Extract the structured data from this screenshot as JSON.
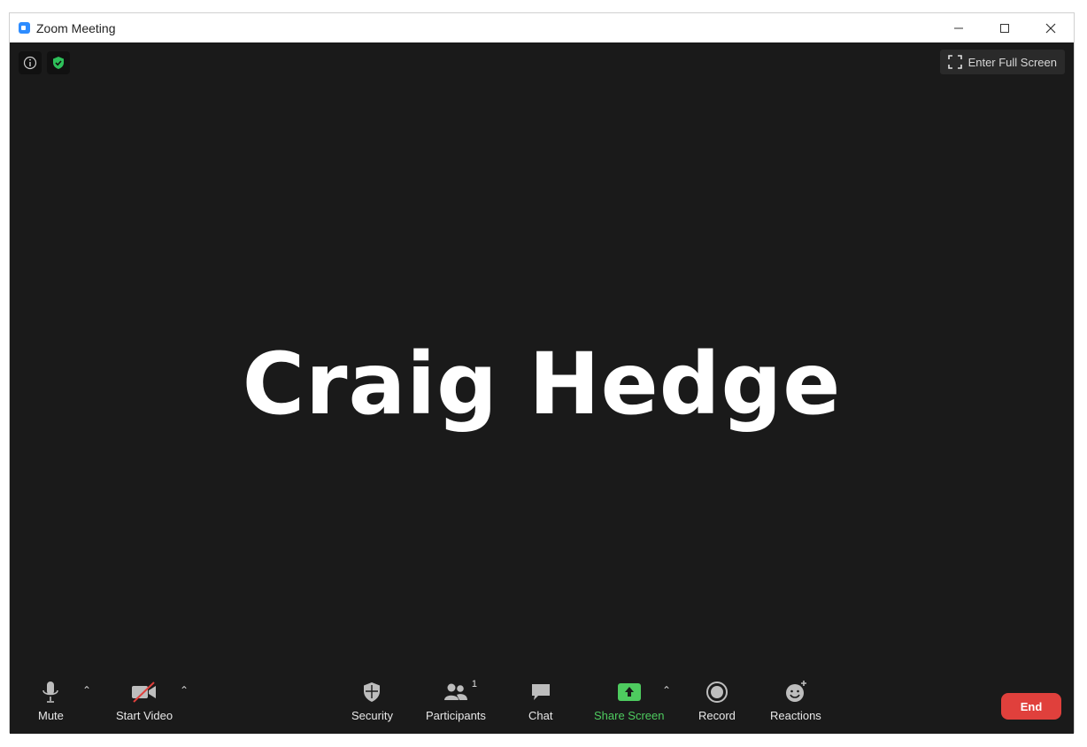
{
  "window": {
    "title": "Zoom Meeting",
    "minimize_label": "minimize",
    "maximize_label": "maximize",
    "close_label": "close"
  },
  "top_left": {
    "info_icon": "info-icon",
    "security_shield_icon": "shield-check-icon"
  },
  "fullscreen": {
    "label": "Enter Full Screen",
    "icon": "expand-icon"
  },
  "participant": {
    "name": "Craig Hedge"
  },
  "toolbar": {
    "mute_label": "Mute",
    "video_label": "Start Video",
    "security_label": "Security",
    "participants_label": "Participants",
    "participants_count": "1",
    "chat_label": "Chat",
    "share_label": "Share Screen",
    "record_label": "Record",
    "reactions_label": "Reactions",
    "end_label": "End"
  },
  "colors": {
    "video_bg": "#1a1a1a",
    "share_green": "#4ecb5f",
    "end_red": "#e0403c",
    "zoom_blue": "#2d8cff"
  }
}
